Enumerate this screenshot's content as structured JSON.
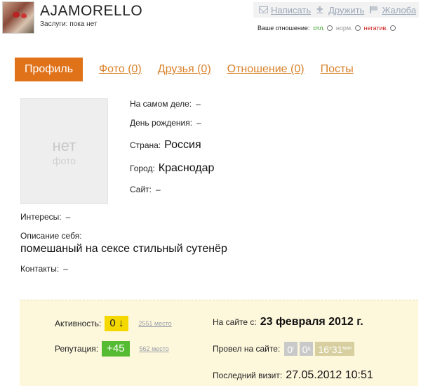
{
  "header": {
    "username": "AJAMORELLO",
    "merits": "Заслуги: пока нет"
  },
  "actions": {
    "write": "Написать",
    "befriend": "Дружить",
    "complain": "Жалоба"
  },
  "attitude": {
    "label": "Ваше отношение:",
    "good": "отл.",
    "normal": "норм.",
    "bad": "негатив."
  },
  "tabs": {
    "active": "Профиль",
    "photos": "Фото (0)",
    "friends": "Друзья (0)",
    "relations": "Отношение (0)",
    "posts": "Посты"
  },
  "photo": {
    "line1": "нет",
    "line2": "фото"
  },
  "profile": {
    "real_label": "На самом деле:",
    "real_value": "–",
    "birthday_label": "День рождения:",
    "birthday_value": "–",
    "country_label": "Страна:",
    "country_value": "Россия",
    "city_label": "Город:",
    "city_value": "Краснодар",
    "site_label": "Сайт:",
    "site_value": "–",
    "interests_label": "Интересы:",
    "interests_value": "–",
    "about_label": "Описание себя:",
    "about_value": "помешаный на сексе стильный сутенёр",
    "contacts_label": "Контакты:",
    "contacts_value": "–"
  },
  "stats": {
    "activity_label": "Активность:",
    "activity_value": "0 ↓",
    "activity_place": "2551 место",
    "reputation_label": "Репутация:",
    "reputation_value": "+45",
    "reputation_place": "562 место",
    "since_label": "На сайте с:",
    "since_value": "23 февраля 2012 г.",
    "spent_label": "Провел на сайте:",
    "spent_days": "0",
    "spent_days_unit": "г",
    "spent_hours": "0",
    "spent_hours_unit": "д",
    "spent_min": "16",
    "spent_min_unit": "ч",
    "spent_sec": "31",
    "spent_sec_unit": "мин",
    "last_visit_label": "Последний визит:",
    "last_visit_value": "27.05.2012 10:51"
  },
  "colors": {
    "accent": "#e0721a",
    "link": "#d9822b",
    "activity_badge": "#f5d800",
    "reputation_badge": "#55bb33",
    "stats_bg": "#fdf7dc"
  }
}
